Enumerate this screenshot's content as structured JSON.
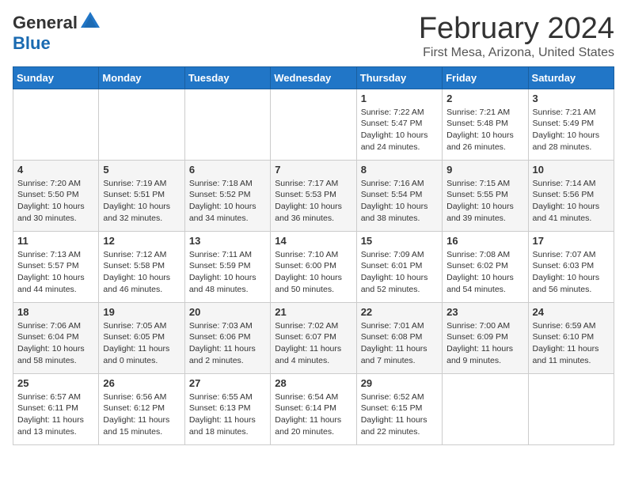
{
  "header": {
    "logo_general": "General",
    "logo_blue": "Blue",
    "month_title": "February 2024",
    "location": "First Mesa, Arizona, United States"
  },
  "days_of_week": [
    "Sunday",
    "Monday",
    "Tuesday",
    "Wednesday",
    "Thursday",
    "Friday",
    "Saturday"
  ],
  "weeks": [
    [
      {
        "day": "",
        "content": ""
      },
      {
        "day": "",
        "content": ""
      },
      {
        "day": "",
        "content": ""
      },
      {
        "day": "",
        "content": ""
      },
      {
        "day": "1",
        "content": "Sunrise: 7:22 AM\nSunset: 5:47 PM\nDaylight: 10 hours\nand 24 minutes."
      },
      {
        "day": "2",
        "content": "Sunrise: 7:21 AM\nSunset: 5:48 PM\nDaylight: 10 hours\nand 26 minutes."
      },
      {
        "day": "3",
        "content": "Sunrise: 7:21 AM\nSunset: 5:49 PM\nDaylight: 10 hours\nand 28 minutes."
      }
    ],
    [
      {
        "day": "4",
        "content": "Sunrise: 7:20 AM\nSunset: 5:50 PM\nDaylight: 10 hours\nand 30 minutes."
      },
      {
        "day": "5",
        "content": "Sunrise: 7:19 AM\nSunset: 5:51 PM\nDaylight: 10 hours\nand 32 minutes."
      },
      {
        "day": "6",
        "content": "Sunrise: 7:18 AM\nSunset: 5:52 PM\nDaylight: 10 hours\nand 34 minutes."
      },
      {
        "day": "7",
        "content": "Sunrise: 7:17 AM\nSunset: 5:53 PM\nDaylight: 10 hours\nand 36 minutes."
      },
      {
        "day": "8",
        "content": "Sunrise: 7:16 AM\nSunset: 5:54 PM\nDaylight: 10 hours\nand 38 minutes."
      },
      {
        "day": "9",
        "content": "Sunrise: 7:15 AM\nSunset: 5:55 PM\nDaylight: 10 hours\nand 39 minutes."
      },
      {
        "day": "10",
        "content": "Sunrise: 7:14 AM\nSunset: 5:56 PM\nDaylight: 10 hours\nand 41 minutes."
      }
    ],
    [
      {
        "day": "11",
        "content": "Sunrise: 7:13 AM\nSunset: 5:57 PM\nDaylight: 10 hours\nand 44 minutes."
      },
      {
        "day": "12",
        "content": "Sunrise: 7:12 AM\nSunset: 5:58 PM\nDaylight: 10 hours\nand 46 minutes."
      },
      {
        "day": "13",
        "content": "Sunrise: 7:11 AM\nSunset: 5:59 PM\nDaylight: 10 hours\nand 48 minutes."
      },
      {
        "day": "14",
        "content": "Sunrise: 7:10 AM\nSunset: 6:00 PM\nDaylight: 10 hours\nand 50 minutes."
      },
      {
        "day": "15",
        "content": "Sunrise: 7:09 AM\nSunset: 6:01 PM\nDaylight: 10 hours\nand 52 minutes."
      },
      {
        "day": "16",
        "content": "Sunrise: 7:08 AM\nSunset: 6:02 PM\nDaylight: 10 hours\nand 54 minutes."
      },
      {
        "day": "17",
        "content": "Sunrise: 7:07 AM\nSunset: 6:03 PM\nDaylight: 10 hours\nand 56 minutes."
      }
    ],
    [
      {
        "day": "18",
        "content": "Sunrise: 7:06 AM\nSunset: 6:04 PM\nDaylight: 10 hours\nand 58 minutes."
      },
      {
        "day": "19",
        "content": "Sunrise: 7:05 AM\nSunset: 6:05 PM\nDaylight: 11 hours\nand 0 minutes."
      },
      {
        "day": "20",
        "content": "Sunrise: 7:03 AM\nSunset: 6:06 PM\nDaylight: 11 hours\nand 2 minutes."
      },
      {
        "day": "21",
        "content": "Sunrise: 7:02 AM\nSunset: 6:07 PM\nDaylight: 11 hours\nand 4 minutes."
      },
      {
        "day": "22",
        "content": "Sunrise: 7:01 AM\nSunset: 6:08 PM\nDaylight: 11 hours\nand 7 minutes."
      },
      {
        "day": "23",
        "content": "Sunrise: 7:00 AM\nSunset: 6:09 PM\nDaylight: 11 hours\nand 9 minutes."
      },
      {
        "day": "24",
        "content": "Sunrise: 6:59 AM\nSunset: 6:10 PM\nDaylight: 11 hours\nand 11 minutes."
      }
    ],
    [
      {
        "day": "25",
        "content": "Sunrise: 6:57 AM\nSunset: 6:11 PM\nDaylight: 11 hours\nand 13 minutes."
      },
      {
        "day": "26",
        "content": "Sunrise: 6:56 AM\nSunset: 6:12 PM\nDaylight: 11 hours\nand 15 minutes."
      },
      {
        "day": "27",
        "content": "Sunrise: 6:55 AM\nSunset: 6:13 PM\nDaylight: 11 hours\nand 18 minutes."
      },
      {
        "day": "28",
        "content": "Sunrise: 6:54 AM\nSunset: 6:14 PM\nDaylight: 11 hours\nand 20 minutes."
      },
      {
        "day": "29",
        "content": "Sunrise: 6:52 AM\nSunset: 6:15 PM\nDaylight: 11 hours\nand 22 minutes."
      },
      {
        "day": "",
        "content": ""
      },
      {
        "day": "",
        "content": ""
      }
    ]
  ]
}
